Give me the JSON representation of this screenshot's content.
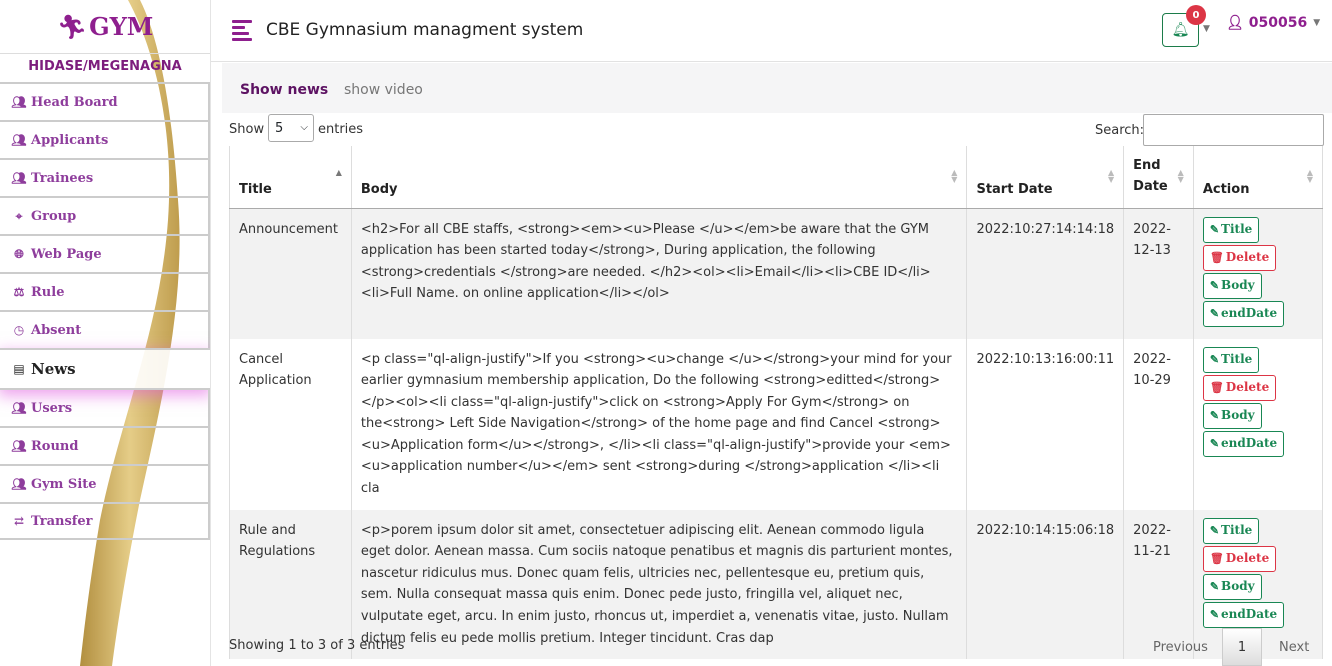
{
  "brand": {
    "logo_text": "GYM",
    "branch": "HIDASE/MEGENAGNA"
  },
  "sidebar": {
    "items": [
      {
        "label": "Head Board",
        "icon": "users-icon"
      },
      {
        "label": "Applicants",
        "icon": "users-icon"
      },
      {
        "label": "Trainees",
        "icon": "users-icon"
      },
      {
        "label": "Group",
        "icon": "group-icon"
      },
      {
        "label": "Web Page",
        "icon": "globe-icon"
      },
      {
        "label": "Rule",
        "icon": "scale-icon"
      },
      {
        "label": "Absent",
        "icon": "clock-icon"
      },
      {
        "label": "News",
        "icon": "newspaper-icon",
        "active": true
      },
      {
        "label": "Users",
        "icon": "users-icon"
      },
      {
        "label": "Round",
        "icon": "users-icon"
      },
      {
        "label": "Gym Site",
        "icon": "users-icon"
      },
      {
        "label": "Transfer",
        "icon": "transfer-icon"
      }
    ]
  },
  "header": {
    "title": "CBE Gymnasium managment system",
    "notification_count": "0",
    "user": "050056"
  },
  "tabs": {
    "active": "Show news",
    "inactive": "show video"
  },
  "table_controls": {
    "show_label": "Show",
    "entries_label": "entries",
    "page_length": "5",
    "search_label": "Search:",
    "search_value": ""
  },
  "columns": [
    "Title",
    "Body",
    "Start Date",
    "End Date",
    "Action"
  ],
  "rows": [
    {
      "title": "Announcement",
      "body": "<h2>For all CBE staffs, <strong><em><u>Please </u></em>be aware that the GYM application has been started today</strong>, During application, the following <strong>credentials </strong>are needed. </h2><ol><li>Email</li><li>CBE ID</li><li>Full Name. on online application</li></ol>",
      "start": "2022:10:27:14:14:18",
      "end": "2022-12-13"
    },
    {
      "title": "Cancel Application",
      "body": "<p class=\"ql-align-justify\">If you <strong><u>change </u></strong>your mind for your earlier gymnasium membership application, Do the following <strong>editted</strong></p><ol><li class=\"ql-align-justify\">click on <strong>Apply For Gym</strong> on the<strong> Left Side Navigation</strong> of the home page and find Cancel <strong><u>Application form</u></strong>, </li><li class=\"ql-align-justify\">provide your <em><u>application number</u></em> sent <strong>during </strong>application </li><li cla",
      "start": "2022:10:13:16:00:11",
      "end": "2022-10-29"
    },
    {
      "title": "Rule and Regulations",
      "body": "<p>porem ipsum dolor sit amet, consectetuer adipiscing elit. Aenean commodo ligula eget dolor. Aenean massa. Cum sociis natoque penatibus et magnis dis parturient montes, nascetur ridiculus mus. Donec quam felis, ultricies nec, pellentesque eu, pretium quis, sem. Nulla consequat massa quis enim. Donec pede justo, fringilla vel, aliquet nec, vulputate eget, arcu. In enim justo, rhoncus ut, imperdiet a, venenatis vitae, justo. Nullam dictum felis eu pede mollis pretium. Integer tincidunt. Cras dap",
      "start": "2022:10:14:15:06:18",
      "end": "2022-11-21"
    }
  ],
  "actions": {
    "title": "Title",
    "delete": "Delete",
    "body": "Body",
    "end_date": "endDate"
  },
  "footer": {
    "info": "Showing 1 to 3 of 3 entries",
    "previous": "Previous",
    "page": "1",
    "next": "Next"
  },
  "colors": {
    "brand": "#8e1f8e",
    "success": "#198754",
    "danger": "#dc3545",
    "ribbon": "#c9a227"
  }
}
